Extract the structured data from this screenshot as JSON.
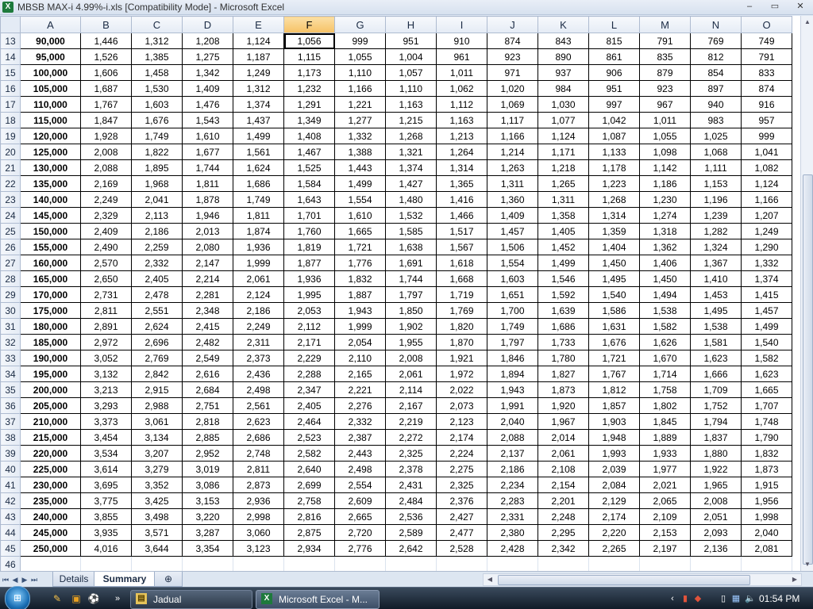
{
  "window": {
    "title": "MBSB MAX-i 4.99%-i.xls  [Compatibility Mode] - Microsoft Excel",
    "app_icon": "X"
  },
  "controls": {
    "minimize": "–",
    "restore": "▭",
    "close": "✕"
  },
  "selected_column": "F",
  "active_cell": {
    "row": 13,
    "col": "F"
  },
  "columns": [
    "A",
    "B",
    "C",
    "D",
    "E",
    "F",
    "G",
    "H",
    "I",
    "J",
    "K",
    "L",
    "M",
    "N",
    "O"
  ],
  "rows": [
    {
      "n": "13",
      "a": "90,000",
      "v": [
        "1,446",
        "1,312",
        "1,208",
        "1,124",
        "1,056",
        "999",
        "951",
        "910",
        "874",
        "843",
        "815",
        "791",
        "769",
        "749"
      ]
    },
    {
      "n": "14",
      "a": "95,000",
      "v": [
        "1,526",
        "1,385",
        "1,275",
        "1,187",
        "1,115",
        "1,055",
        "1,004",
        "961",
        "923",
        "890",
        "861",
        "835",
        "812",
        "791"
      ]
    },
    {
      "n": "15",
      "a": "100,000",
      "v": [
        "1,606",
        "1,458",
        "1,342",
        "1,249",
        "1,173",
        "1,110",
        "1,057",
        "1,011",
        "971",
        "937",
        "906",
        "879",
        "854",
        "833"
      ]
    },
    {
      "n": "16",
      "a": "105,000",
      "v": [
        "1,687",
        "1,530",
        "1,409",
        "1,312",
        "1,232",
        "1,166",
        "1,110",
        "1,062",
        "1,020",
        "984",
        "951",
        "923",
        "897",
        "874"
      ]
    },
    {
      "n": "17",
      "a": "110,000",
      "v": [
        "1,767",
        "1,603",
        "1,476",
        "1,374",
        "1,291",
        "1,221",
        "1,163",
        "1,112",
        "1,069",
        "1,030",
        "997",
        "967",
        "940",
        "916"
      ]
    },
    {
      "n": "18",
      "a": "115,000",
      "v": [
        "1,847",
        "1,676",
        "1,543",
        "1,437",
        "1,349",
        "1,277",
        "1,215",
        "1,163",
        "1,117",
        "1,077",
        "1,042",
        "1,011",
        "983",
        "957"
      ]
    },
    {
      "n": "19",
      "a": "120,000",
      "v": [
        "1,928",
        "1,749",
        "1,610",
        "1,499",
        "1,408",
        "1,332",
        "1,268",
        "1,213",
        "1,166",
        "1,124",
        "1,087",
        "1,055",
        "1,025",
        "999"
      ]
    },
    {
      "n": "20",
      "a": "125,000",
      "v": [
        "2,008",
        "1,822",
        "1,677",
        "1,561",
        "1,467",
        "1,388",
        "1,321",
        "1,264",
        "1,214",
        "1,171",
        "1,133",
        "1,098",
        "1,068",
        "1,041"
      ]
    },
    {
      "n": "21",
      "a": "130,000",
      "v": [
        "2,088",
        "1,895",
        "1,744",
        "1,624",
        "1,525",
        "1,443",
        "1,374",
        "1,314",
        "1,263",
        "1,218",
        "1,178",
        "1,142",
        "1,111",
        "1,082"
      ]
    },
    {
      "n": "22",
      "a": "135,000",
      "v": [
        "2,169",
        "1,968",
        "1,811",
        "1,686",
        "1,584",
        "1,499",
        "1,427",
        "1,365",
        "1,311",
        "1,265",
        "1,223",
        "1,186",
        "1,153",
        "1,124"
      ]
    },
    {
      "n": "23",
      "a": "140,000",
      "v": [
        "2,249",
        "2,041",
        "1,878",
        "1,749",
        "1,643",
        "1,554",
        "1,480",
        "1,416",
        "1,360",
        "1,311",
        "1,268",
        "1,230",
        "1,196",
        "1,166"
      ]
    },
    {
      "n": "24",
      "a": "145,000",
      "v": [
        "2,329",
        "2,113",
        "1,946",
        "1,811",
        "1,701",
        "1,610",
        "1,532",
        "1,466",
        "1,409",
        "1,358",
        "1,314",
        "1,274",
        "1,239",
        "1,207"
      ]
    },
    {
      "n": "25",
      "a": "150,000",
      "v": [
        "2,409",
        "2,186",
        "2,013",
        "1,874",
        "1,760",
        "1,665",
        "1,585",
        "1,517",
        "1,457",
        "1,405",
        "1,359",
        "1,318",
        "1,282",
        "1,249"
      ]
    },
    {
      "n": "26",
      "a": "155,000",
      "v": [
        "2,490",
        "2,259",
        "2,080",
        "1,936",
        "1,819",
        "1,721",
        "1,638",
        "1,567",
        "1,506",
        "1,452",
        "1,404",
        "1,362",
        "1,324",
        "1,290"
      ]
    },
    {
      "n": "27",
      "a": "160,000",
      "v": [
        "2,570",
        "2,332",
        "2,147",
        "1,999",
        "1,877",
        "1,776",
        "1,691",
        "1,618",
        "1,554",
        "1,499",
        "1,450",
        "1,406",
        "1,367",
        "1,332"
      ]
    },
    {
      "n": "28",
      "a": "165,000",
      "v": [
        "2,650",
        "2,405",
        "2,214",
        "2,061",
        "1,936",
        "1,832",
        "1,744",
        "1,668",
        "1,603",
        "1,546",
        "1,495",
        "1,450",
        "1,410",
        "1,374"
      ]
    },
    {
      "n": "29",
      "a": "170,000",
      "v": [
        "2,731",
        "2,478",
        "2,281",
        "2,124",
        "1,995",
        "1,887",
        "1,797",
        "1,719",
        "1,651",
        "1,592",
        "1,540",
        "1,494",
        "1,453",
        "1,415"
      ]
    },
    {
      "n": "30",
      "a": "175,000",
      "v": [
        "2,811",
        "2,551",
        "2,348",
        "2,186",
        "2,053",
        "1,943",
        "1,850",
        "1,769",
        "1,700",
        "1,639",
        "1,586",
        "1,538",
        "1,495",
        "1,457"
      ]
    },
    {
      "n": "31",
      "a": "180,000",
      "v": [
        "2,891",
        "2,624",
        "2,415",
        "2,249",
        "2,112",
        "1,999",
        "1,902",
        "1,820",
        "1,749",
        "1,686",
        "1,631",
        "1,582",
        "1,538",
        "1,499"
      ]
    },
    {
      "n": "32",
      "a": "185,000",
      "v": [
        "2,972",
        "2,696",
        "2,482",
        "2,311",
        "2,171",
        "2,054",
        "1,955",
        "1,870",
        "1,797",
        "1,733",
        "1,676",
        "1,626",
        "1,581",
        "1,540"
      ]
    },
    {
      "n": "33",
      "a": "190,000",
      "v": [
        "3,052",
        "2,769",
        "2,549",
        "2,373",
        "2,229",
        "2,110",
        "2,008",
        "1,921",
        "1,846",
        "1,780",
        "1,721",
        "1,670",
        "1,623",
        "1,582"
      ]
    },
    {
      "n": "34",
      "a": "195,000",
      "v": [
        "3,132",
        "2,842",
        "2,616",
        "2,436",
        "2,288",
        "2,165",
        "2,061",
        "1,972",
        "1,894",
        "1,827",
        "1,767",
        "1,714",
        "1,666",
        "1,623"
      ]
    },
    {
      "n": "35",
      "a": "200,000",
      "v": [
        "3,213",
        "2,915",
        "2,684",
        "2,498",
        "2,347",
        "2,221",
        "2,114",
        "2,022",
        "1,943",
        "1,873",
        "1,812",
        "1,758",
        "1,709",
        "1,665"
      ]
    },
    {
      "n": "36",
      "a": "205,000",
      "v": [
        "3,293",
        "2,988",
        "2,751",
        "2,561",
        "2,405",
        "2,276",
        "2,167",
        "2,073",
        "1,991",
        "1,920",
        "1,857",
        "1,802",
        "1,752",
        "1,707"
      ]
    },
    {
      "n": "37",
      "a": "210,000",
      "v": [
        "3,373",
        "3,061",
        "2,818",
        "2,623",
        "2,464",
        "2,332",
        "2,219",
        "2,123",
        "2,040",
        "1,967",
        "1,903",
        "1,845",
        "1,794",
        "1,748"
      ]
    },
    {
      "n": "38",
      "a": "215,000",
      "v": [
        "3,454",
        "3,134",
        "2,885",
        "2,686",
        "2,523",
        "2,387",
        "2,272",
        "2,174",
        "2,088",
        "2,014",
        "1,948",
        "1,889",
        "1,837",
        "1,790"
      ]
    },
    {
      "n": "39",
      "a": "220,000",
      "v": [
        "3,534",
        "3,207",
        "2,952",
        "2,748",
        "2,582",
        "2,443",
        "2,325",
        "2,224",
        "2,137",
        "2,061",
        "1,993",
        "1,933",
        "1,880",
        "1,832"
      ]
    },
    {
      "n": "40",
      "a": "225,000",
      "v": [
        "3,614",
        "3,279",
        "3,019",
        "2,811",
        "2,640",
        "2,498",
        "2,378",
        "2,275",
        "2,186",
        "2,108",
        "2,039",
        "1,977",
        "1,922",
        "1,873"
      ]
    },
    {
      "n": "41",
      "a": "230,000",
      "v": [
        "3,695",
        "3,352",
        "3,086",
        "2,873",
        "2,699",
        "2,554",
        "2,431",
        "2,325",
        "2,234",
        "2,154",
        "2,084",
        "2,021",
        "1,965",
        "1,915"
      ]
    },
    {
      "n": "42",
      "a": "235,000",
      "v": [
        "3,775",
        "3,425",
        "3,153",
        "2,936",
        "2,758",
        "2,609",
        "2,484",
        "2,376",
        "2,283",
        "2,201",
        "2,129",
        "2,065",
        "2,008",
        "1,956"
      ]
    },
    {
      "n": "43",
      "a": "240,000",
      "v": [
        "3,855",
        "3,498",
        "3,220",
        "2,998",
        "2,816",
        "2,665",
        "2,536",
        "2,427",
        "2,331",
        "2,248",
        "2,174",
        "2,109",
        "2,051",
        "1,998"
      ]
    },
    {
      "n": "44",
      "a": "245,000",
      "v": [
        "3,935",
        "3,571",
        "3,287",
        "3,060",
        "2,875",
        "2,720",
        "2,589",
        "2,477",
        "2,380",
        "2,295",
        "2,220",
        "2,153",
        "2,093",
        "2,040"
      ]
    },
    {
      "n": "45",
      "a": "250,000",
      "v": [
        "4,016",
        "3,644",
        "3,354",
        "3,123",
        "2,934",
        "2,776",
        "2,642",
        "2,528",
        "2,428",
        "2,342",
        "2,265",
        "2,197",
        "2,136",
        "2,081"
      ]
    }
  ],
  "empty_rows": [
    "46"
  ],
  "sheet_tabs": {
    "details": "Details",
    "summary": "Summary",
    "insert_icon": "insert-sheet-icon"
  },
  "taskbar": {
    "tasks": [
      {
        "label": "Jadual",
        "icon": "folder-icon"
      },
      {
        "label": "Microsoft Excel - M...",
        "icon": "excel-icon"
      }
    ],
    "clock": "01:54 PM"
  },
  "colors": {
    "accent": "#f6c165",
    "header": "#e4ebf5",
    "taskbar": "#0f1a26"
  }
}
